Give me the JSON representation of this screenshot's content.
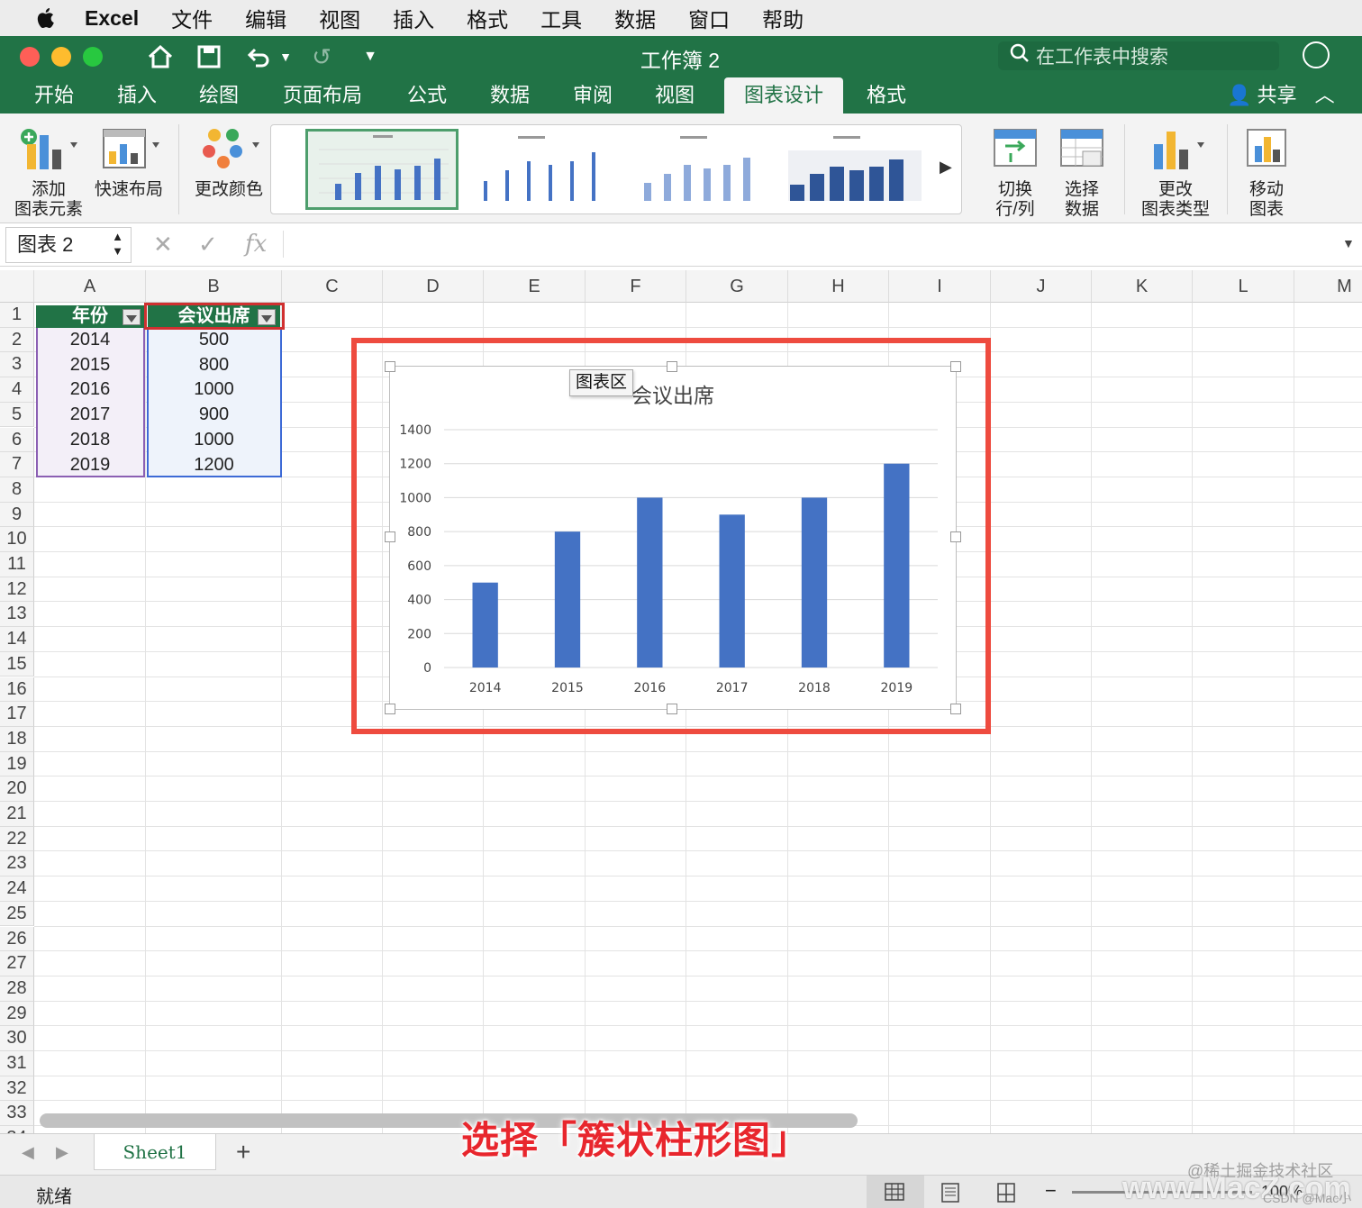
{
  "menubar": {
    "app": "Excel",
    "items": [
      "文件",
      "编辑",
      "视图",
      "插入",
      "格式",
      "工具",
      "数据",
      "窗口",
      "帮助"
    ]
  },
  "window": {
    "title": "工作簿 2",
    "search_placeholder": "在工作表中搜索"
  },
  "tabs": [
    "开始",
    "插入",
    "绘图",
    "页面布局",
    "公式",
    "数据",
    "审阅",
    "视图",
    "图表设计",
    "格式"
  ],
  "active_tab": "图表设计",
  "share_label": "共享",
  "ribbon": {
    "add_element": [
      "添加",
      "图表元素"
    ],
    "quick_layout": "快速布局",
    "change_colors": "更改颜色",
    "switch_row_col": [
      "切换",
      "行/列"
    ],
    "select_data": [
      "选择",
      "数据"
    ],
    "change_type": [
      "更改",
      "图表类型"
    ],
    "move_chart": [
      "移动",
      "图表"
    ]
  },
  "formula_bar": {
    "name_box": "图表 2",
    "fx": "fx"
  },
  "columns": [
    "A",
    "B",
    "C",
    "D",
    "E",
    "F",
    "G",
    "H",
    "I",
    "J",
    "K",
    "L",
    "M"
  ],
  "table": {
    "headers": [
      "年份",
      "会议出席"
    ],
    "rows": [
      [
        "2014",
        "500"
      ],
      [
        "2015",
        "800"
      ],
      [
        "2016",
        "1000"
      ],
      [
        "2017",
        "900"
      ],
      [
        "2018",
        "1000"
      ],
      [
        "2019",
        "1200"
      ]
    ]
  },
  "chart_tooltip": "图表区",
  "chart_data": {
    "type": "bar",
    "title": "会议出席",
    "categories": [
      "2014",
      "2015",
      "2016",
      "2017",
      "2018",
      "2019"
    ],
    "values": [
      500,
      800,
      1000,
      900,
      1000,
      1200
    ],
    "ylim": [
      0,
      1400
    ],
    "yticks": [
      0,
      200,
      400,
      600,
      800,
      1000,
      1200,
      1400
    ],
    "grid": true,
    "bar_color": "#4472c4"
  },
  "sheet": {
    "tab": "Sheet1",
    "add": "+"
  },
  "status": {
    "ready": "就绪",
    "zoom": "100%"
  },
  "caption": "选择「簇状柱形图」",
  "watermarks": [
    "@稀土掘金技术社区",
    "www.MacZ.com",
    "CSDN @Mac小白"
  ],
  "colors": {
    "excel_green": "#217346",
    "highlight_red": "#ee4b3f"
  }
}
